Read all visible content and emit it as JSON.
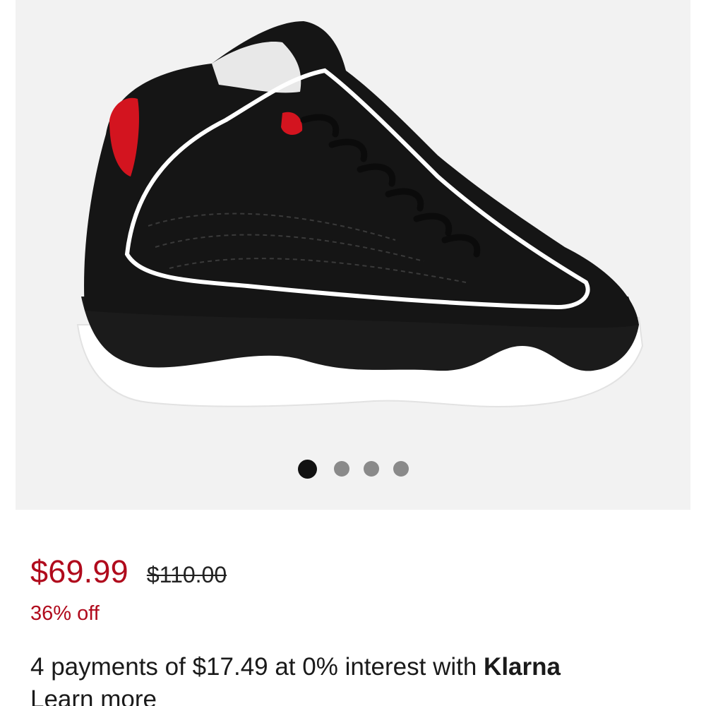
{
  "product": {
    "sale_price": "$69.99",
    "original_price": "$110.00",
    "discount": "36% off"
  },
  "gallery": {
    "image_count": 4,
    "active_index": 0
  },
  "klarna": {
    "text": "4 payments of $17.49 at 0% interest with",
    "brand": "Klarna",
    "learn_more": "Learn more"
  },
  "colors": {
    "sale": "#b00a1c",
    "text": "#1a1a1a",
    "gallery_bg": "#f2f2f2",
    "dot_active": "#111111",
    "dot_inactive": "#8a8a8a",
    "shoe_upper": "#151515",
    "shoe_accent": "#d3141f",
    "shoe_sole": "#ffffff"
  }
}
